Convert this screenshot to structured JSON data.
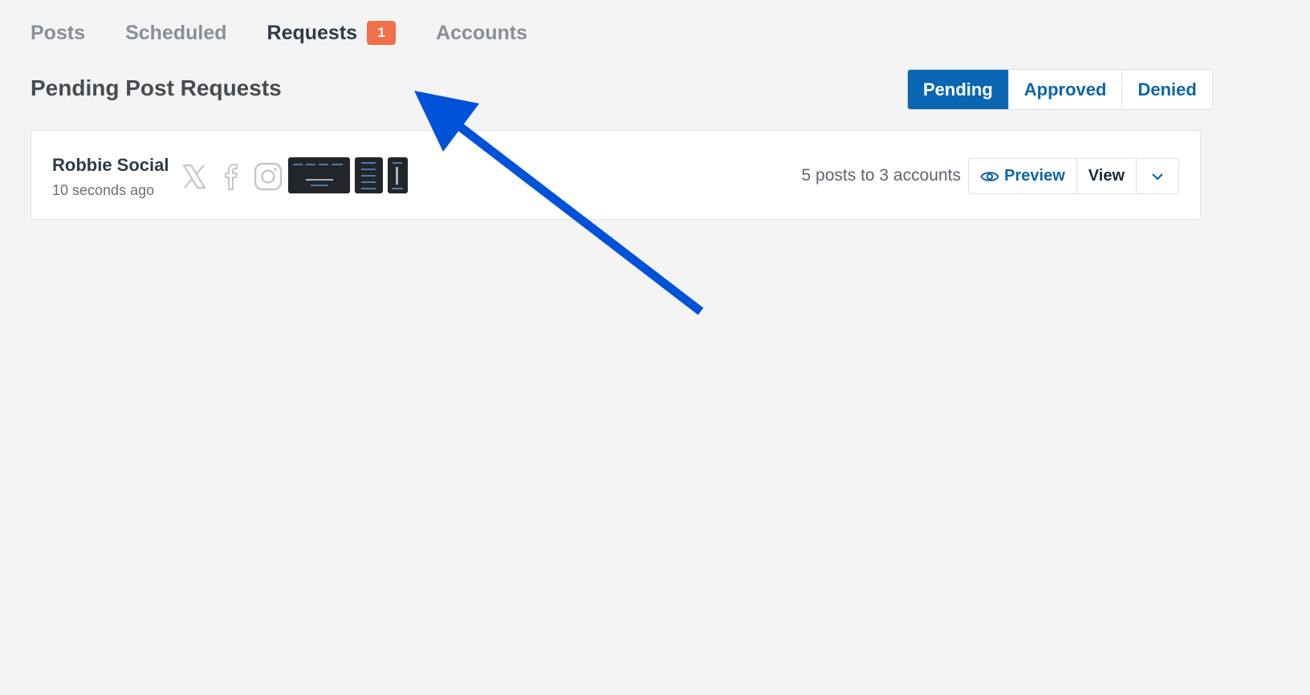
{
  "tabs": [
    {
      "label": "Posts"
    },
    {
      "label": "Scheduled"
    },
    {
      "label": "Requests",
      "badge": "1"
    },
    {
      "label": "Accounts"
    }
  ],
  "page_title": "Pending Post Requests",
  "filters": [
    {
      "label": "Pending",
      "active": true
    },
    {
      "label": "Approved"
    },
    {
      "label": "Denied"
    }
  ],
  "request": {
    "name": "Robbie Social",
    "time": "10 seconds ago",
    "networks": [
      "x-icon",
      "facebook-icon",
      "instagram-icon"
    ],
    "summary": "5 posts to 3 accounts",
    "actions": {
      "preview": "Preview",
      "view": "View"
    }
  },
  "colors": {
    "accent": "#0a66b2",
    "badge": "#f0704a",
    "arrow": "#0052d9"
  }
}
